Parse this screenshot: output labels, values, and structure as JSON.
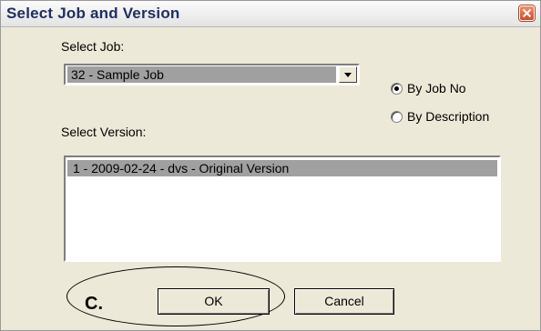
{
  "window": {
    "title": "Select Job and Version"
  },
  "job": {
    "label": "Select Job:",
    "selected": "32 - Sample Job"
  },
  "sort": {
    "options": [
      {
        "label": "By Job No",
        "checked": true
      },
      {
        "label": "By Description",
        "checked": false
      }
    ]
  },
  "version": {
    "label": "Select Version:",
    "items": [
      "1 - 2009-02-24 - dvs - Original Version"
    ]
  },
  "buttons": {
    "ok_label": "OK",
    "cancel_label": "Cancel"
  },
  "annotation": {
    "text": "C."
  },
  "icons": {
    "close": "close-icon",
    "dropdown": "chevron-down-icon"
  },
  "colors": {
    "dialog_bg": "#ece9d8",
    "selection": "#a0a0a0",
    "title_text": "#1f2f63",
    "close_button": "#cf4a24"
  }
}
